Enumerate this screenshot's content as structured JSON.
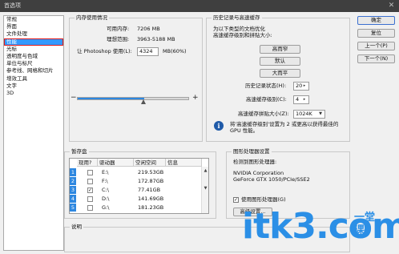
{
  "window": {
    "title": "首选项"
  },
  "sidebar": {
    "items": [
      {
        "label": "常规"
      },
      {
        "label": "界面"
      },
      {
        "label": "文件处理"
      },
      {
        "label": "性能"
      },
      {
        "label": "光标"
      },
      {
        "label": "透明度与色域"
      },
      {
        "label": "单位与标尺"
      },
      {
        "label": "参考线、网格和切片"
      },
      {
        "label": "增效工具"
      },
      {
        "label": "文字"
      },
      {
        "label": "3D"
      }
    ],
    "active_index": 3
  },
  "memory": {
    "title": "内存使用情况",
    "available_label": "可用内存:",
    "available_value": "7206 MB",
    "ideal_label": "理想范围:",
    "ideal_value": "3963-5188 MB",
    "use_label": "让 Photoshop 使用(L):",
    "use_value": "4324",
    "use_suffix": "MB(60%)",
    "minus": "−",
    "plus": "+",
    "slider_percent": 60
  },
  "history": {
    "title": "历史记录与高速缓存",
    "desc1": "为以下类型的文档优化",
    "desc2": "高速缓存级别和拼贴大小:",
    "btn_tall": "高而窄",
    "btn_default": "默认",
    "btn_wide": "大而平",
    "states_label": "历史记录状态(H):",
    "states_value": "20",
    "levels_label": "高速缓存级别(C):",
    "levels_value": "4",
    "tile_label": "高速缓存拼贴大小(Z):",
    "tile_value": "1024K",
    "note": "将'高速缓存级别'设置为 2 或更高以获得最佳的 GPU 性能。"
  },
  "scratch": {
    "title": "暂存盘",
    "headers": [
      "现用?",
      "驱动器",
      "空闲空间",
      "信息"
    ],
    "rows": [
      {
        "num": "1",
        "checked": false,
        "drive": "E:\\",
        "space": "219.53GB"
      },
      {
        "num": "2",
        "checked": false,
        "drive": "F:\\",
        "space": "172.87GB"
      },
      {
        "num": "3",
        "checked": true,
        "drive": "C:\\",
        "space": "77.41GB"
      },
      {
        "num": "4",
        "checked": false,
        "drive": "D:\\",
        "space": "141.69GB"
      },
      {
        "num": "5",
        "checked": false,
        "drive": "G:\\",
        "space": "181.23GB"
      }
    ]
  },
  "gpu": {
    "title": "图形处理器设置",
    "detected_label": "检测到图形处理器:",
    "vendor": "NVIDIA Corporation",
    "model": "GeForce GTX 1050/PCIe/SSE2",
    "use_gpu_label": "使用图形处理器(G)",
    "use_gpu_checked": true,
    "advanced_btn": "高级设置..."
  },
  "description": {
    "title": "说明"
  },
  "buttons": {
    "ok": "确定",
    "reset": "复位",
    "prev": "上一个(P)",
    "next": "下一个(N)"
  },
  "watermark": {
    "main": "itk3.com",
    "side1": "一堂",
    "side2": "课"
  },
  "colors": {
    "accent": "#3399ff",
    "highlight_outline": "#e01818",
    "watermark": "#2b8fe6"
  }
}
